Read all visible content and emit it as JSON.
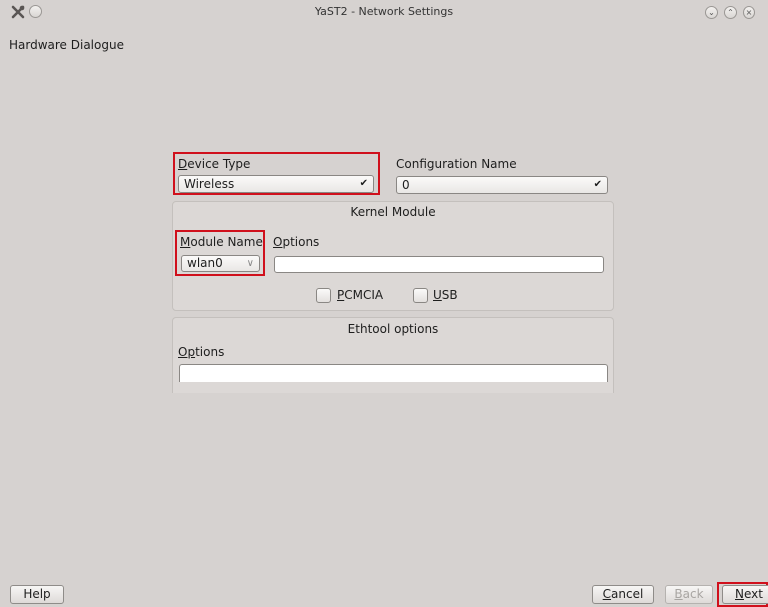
{
  "window": {
    "title": "YaST2 - Network Settings"
  },
  "page": {
    "heading": "Hardware Dialogue"
  },
  "device_type": {
    "label_first": "D",
    "label_rest": "evice Type",
    "value": "Wireless"
  },
  "configuration_name": {
    "label": "Configuration Name",
    "value": "0"
  },
  "kernel_module": {
    "title": "Kernel Module",
    "module_name_label_first": "M",
    "module_name_label_rest": "odule Name",
    "module_name_value": "wlan0",
    "options_label_first": "O",
    "options_label_rest": "ptions",
    "options_value": "",
    "pcmcia_first": "P",
    "pcmcia_rest": "CMCIA",
    "usb_first": "U",
    "usb_rest": "SB"
  },
  "ethtool": {
    "title": "Ethtool options",
    "options_label_a": "O",
    "options_label_b": "p",
    "options_label_c": "tions",
    "options_value": ""
  },
  "footer": {
    "help": "Help",
    "cancel_first": "C",
    "cancel_rest": "ancel",
    "back_first": "B",
    "back_rest": "ack",
    "next_first": "N",
    "next_rest": "ext"
  },
  "icons": {
    "app": "yast-tools-icon",
    "pin": "pin-circle-icon",
    "minimize": "minimize-icon",
    "maximize": "maximize-icon",
    "close": "close-icon",
    "combo_arrow": "chevron-down-icon"
  },
  "colors": {
    "highlight": "#d0101c",
    "window_bg": "#d6d2d0"
  }
}
